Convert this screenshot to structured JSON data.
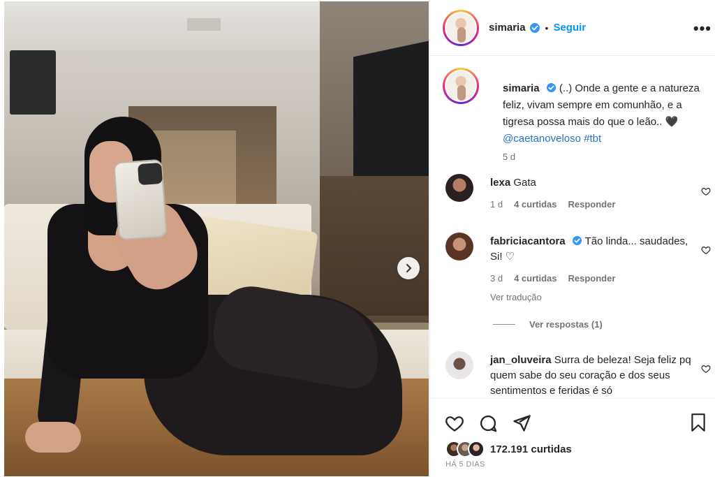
{
  "post": {
    "username": "simaria",
    "follow_label": "Seguir",
    "more_label": "•••"
  },
  "caption": {
    "username": "simaria",
    "text": "(..) Onde a gente e a natureza feliz, vivam sempre em comunhão, e a tigresa possa mais do que o leão.. 🖤 ",
    "mention": "@caetanoveloso",
    "hashtag": "#tbt",
    "time": "5 d"
  },
  "comments": [
    {
      "username": "lexa",
      "text": "Gata",
      "time": "1 d",
      "likes": "4 curtidas",
      "reply": "Responder"
    },
    {
      "username": "fabriciacantora",
      "verified": true,
      "text": "Tão linda... saudades, Si! ♡",
      "time": "3 d",
      "likes": "4 curtidas",
      "reply": "Responder",
      "translate": "Ver tradução"
    },
    {
      "username": "jan_oluveira",
      "text": "Surra de beleza! Seja feliz pq quem sabe do seu coração e dos seus sentimentos e feridas é só"
    }
  ],
  "view_replies": "Ver respostas (1)",
  "footer": {
    "likes_count": "172.191",
    "likes_label": "curtidas",
    "posted_ago": "HÁ 5 DIAS"
  },
  "colors": {
    "accent": "#0095f6",
    "text": "#262626",
    "muted": "#737373",
    "verified": "#3897f0"
  }
}
